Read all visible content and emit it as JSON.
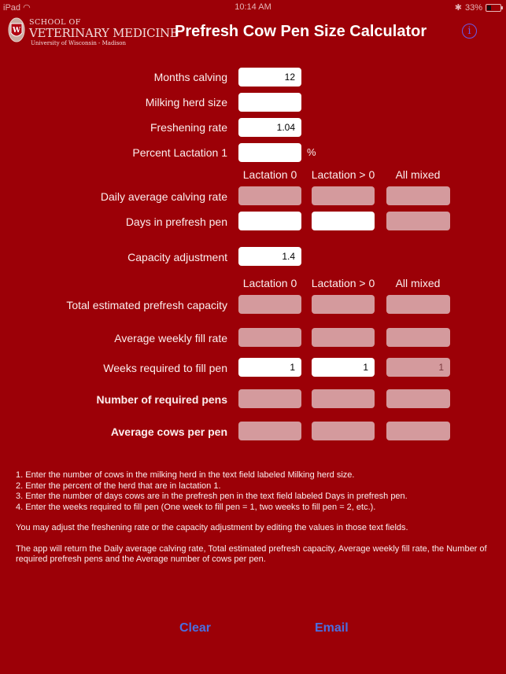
{
  "status_bar": {
    "device": "iPad",
    "wifi_icon": "wifi-icon",
    "time": "10:14 AM",
    "bluetooth_icon": "bluetooth-icon",
    "battery": "33%"
  },
  "header": {
    "logo": {
      "line1": "SCHOOL OF",
      "line2": "VETERINARY MEDICINE",
      "line3": "University of Wisconsin - Madison"
    },
    "title": "Prefresh Cow Pen Size Calculator",
    "info_icon": "i"
  },
  "inputs": {
    "months_calving": {
      "label": "Months calving",
      "value": "12"
    },
    "milking_herd_size": {
      "label": "Milking herd size",
      "value": ""
    },
    "freshening_rate": {
      "label": "Freshening rate",
      "value": "1.04"
    },
    "percent_lactation_1": {
      "label": "Percent Lactation 1",
      "value": "",
      "unit": "%"
    }
  },
  "columns": [
    "Lactation 0",
    "Lactation > 0",
    "All mixed"
  ],
  "section1": {
    "daily_avg_calving_rate": {
      "label": "Daily average calving rate",
      "values": [
        "",
        "",
        ""
      ]
    },
    "days_in_prefresh_pen": {
      "label": "Days in prefresh pen",
      "values": [
        "",
        "",
        ""
      ]
    }
  },
  "capacity_adjustment": {
    "label": "Capacity adjustment",
    "value": "1.4"
  },
  "section2": {
    "total_estimated_capacity": {
      "label": "Total estimated prefresh capacity",
      "values": [
        "",
        "",
        ""
      ]
    },
    "avg_weekly_fill_rate": {
      "label": "Average weekly fill rate",
      "values": [
        "",
        "",
        ""
      ]
    },
    "weeks_required": {
      "label": "Weeks required to fill pen",
      "values": [
        "1",
        "1",
        "1"
      ]
    },
    "number_required_pens": {
      "label": "Number of required pens",
      "values": [
        "",
        "",
        ""
      ]
    },
    "avg_cows_per_pen": {
      "label": "Average cows per pen",
      "values": [
        "",
        "",
        ""
      ]
    }
  },
  "instructions": {
    "steps": [
      "1. Enter the number of cows in the milking herd in the text field labeled Milking herd size.",
      "2. Enter the percent of the herd that are in lactation 1.",
      "3. Enter the number of days cows are in the prefresh pen in the text field labeled Days in prefresh pen.",
      "4. Enter the weeks required to fill pen (One week to fill pen = 1, two weeks to fill pen = 2, etc.)."
    ],
    "note1": "You may adjust the freshening rate or the capacity adjustment by editing the values in those text fields.",
    "note2": "The app will return the Daily average calving rate, Total estimated prefresh capacity, Average weekly fill rate, the Number of required prefresh pens and the Average number of cows per pen."
  },
  "buttons": {
    "clear": "Clear",
    "email": "Email"
  },
  "colors": {
    "background": "#9c0007",
    "disabled_field": "#d49a9d",
    "button_text": "#4a6ee0",
    "info_icon": "#6a5ae8"
  }
}
